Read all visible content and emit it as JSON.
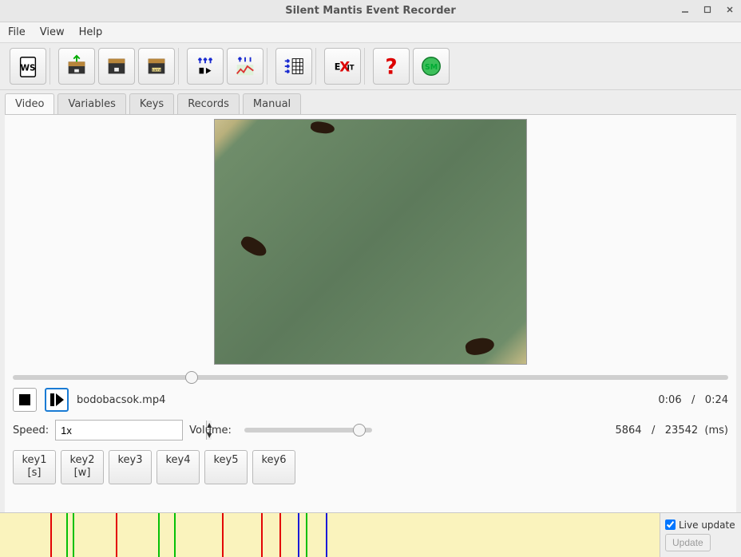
{
  "window": {
    "title": "Silent Mantis Event Recorder"
  },
  "menu": {
    "file": "File",
    "view": "View",
    "help": "Help"
  },
  "toolbar": {
    "ws_label": "WS",
    "exit_label_pre": "E",
    "exit_label_mid": "X",
    "exit_label_post": "IT",
    "sm_label": "SM"
  },
  "tabs": {
    "video": "Video",
    "variables": "Variables",
    "keys": "Keys",
    "records": "Records",
    "manual": "Manual"
  },
  "playback": {
    "filename": "bodobacsok.mp4",
    "time_current": "0:06",
    "time_separator": "/",
    "time_total": "0:24",
    "seek_percent": 25,
    "speed_label": "Speed:",
    "speed_value": "1x",
    "volume_label": "Volume:",
    "volume_percent": 90,
    "ms_current": "5864",
    "ms_separator": "/",
    "ms_total": "23542",
    "ms_unit": "(ms)"
  },
  "keys": [
    {
      "label": "key1",
      "sub": "[s]"
    },
    {
      "label": "key2",
      "sub": "[w]"
    },
    {
      "label": "key3",
      "sub": ""
    },
    {
      "label": "key4",
      "sub": ""
    },
    {
      "label": "key5",
      "sub": ""
    },
    {
      "label": "key6",
      "sub": ""
    }
  ],
  "timeline_markers": [
    {
      "pos": 7.6,
      "color": "red"
    },
    {
      "pos": 10.0,
      "color": "green"
    },
    {
      "pos": 11.0,
      "color": "green"
    },
    {
      "pos": 17.6,
      "color": "red"
    },
    {
      "pos": 24.0,
      "color": "green"
    },
    {
      "pos": 26.4,
      "color": "green"
    },
    {
      "pos": 33.6,
      "color": "red"
    },
    {
      "pos": 39.6,
      "color": "red"
    },
    {
      "pos": 42.4,
      "color": "red"
    },
    {
      "pos": 45.2,
      "color": "blue"
    },
    {
      "pos": 46.4,
      "color": "green"
    },
    {
      "pos": 49.4,
      "color": "blue"
    }
  ],
  "live": {
    "checkbox_label": "Live update",
    "checked": true,
    "button_label": "Update"
  }
}
